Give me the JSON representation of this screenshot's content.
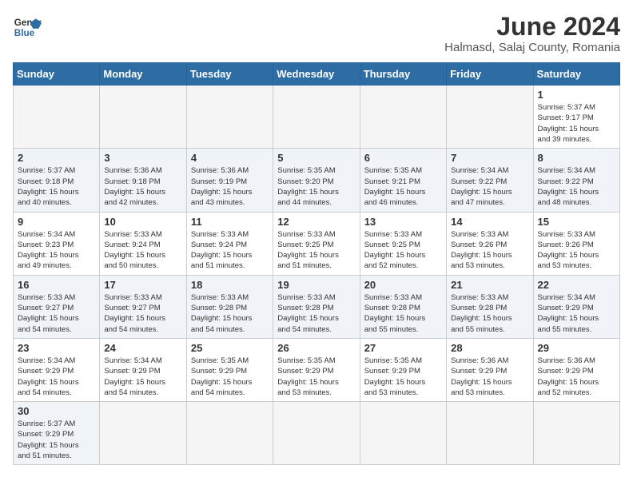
{
  "header": {
    "logo_general": "General",
    "logo_blue": "Blue",
    "month_year": "June 2024",
    "location": "Halmasd, Salaj County, Romania"
  },
  "weekdays": [
    "Sunday",
    "Monday",
    "Tuesday",
    "Wednesday",
    "Thursday",
    "Friday",
    "Saturday"
  ],
  "weeks": [
    [
      {
        "day": "",
        "info": ""
      },
      {
        "day": "",
        "info": ""
      },
      {
        "day": "",
        "info": ""
      },
      {
        "day": "",
        "info": ""
      },
      {
        "day": "",
        "info": ""
      },
      {
        "day": "",
        "info": ""
      },
      {
        "day": "1",
        "info": "Sunrise: 5:37 AM\nSunset: 9:17 PM\nDaylight: 15 hours\nand 39 minutes."
      }
    ],
    [
      {
        "day": "2",
        "info": "Sunrise: 5:37 AM\nSunset: 9:18 PM\nDaylight: 15 hours\nand 40 minutes."
      },
      {
        "day": "3",
        "info": "Sunrise: 5:36 AM\nSunset: 9:18 PM\nDaylight: 15 hours\nand 42 minutes."
      },
      {
        "day": "4",
        "info": "Sunrise: 5:36 AM\nSunset: 9:19 PM\nDaylight: 15 hours\nand 43 minutes."
      },
      {
        "day": "5",
        "info": "Sunrise: 5:35 AM\nSunset: 9:20 PM\nDaylight: 15 hours\nand 44 minutes."
      },
      {
        "day": "6",
        "info": "Sunrise: 5:35 AM\nSunset: 9:21 PM\nDaylight: 15 hours\nand 46 minutes."
      },
      {
        "day": "7",
        "info": "Sunrise: 5:34 AM\nSunset: 9:22 PM\nDaylight: 15 hours\nand 47 minutes."
      },
      {
        "day": "8",
        "info": "Sunrise: 5:34 AM\nSunset: 9:22 PM\nDaylight: 15 hours\nand 48 minutes."
      }
    ],
    [
      {
        "day": "9",
        "info": "Sunrise: 5:34 AM\nSunset: 9:23 PM\nDaylight: 15 hours\nand 49 minutes."
      },
      {
        "day": "10",
        "info": "Sunrise: 5:33 AM\nSunset: 9:24 PM\nDaylight: 15 hours\nand 50 minutes."
      },
      {
        "day": "11",
        "info": "Sunrise: 5:33 AM\nSunset: 9:24 PM\nDaylight: 15 hours\nand 51 minutes."
      },
      {
        "day": "12",
        "info": "Sunrise: 5:33 AM\nSunset: 9:25 PM\nDaylight: 15 hours\nand 51 minutes."
      },
      {
        "day": "13",
        "info": "Sunrise: 5:33 AM\nSunset: 9:25 PM\nDaylight: 15 hours\nand 52 minutes."
      },
      {
        "day": "14",
        "info": "Sunrise: 5:33 AM\nSunset: 9:26 PM\nDaylight: 15 hours\nand 53 minutes."
      },
      {
        "day": "15",
        "info": "Sunrise: 5:33 AM\nSunset: 9:26 PM\nDaylight: 15 hours\nand 53 minutes."
      }
    ],
    [
      {
        "day": "16",
        "info": "Sunrise: 5:33 AM\nSunset: 9:27 PM\nDaylight: 15 hours\nand 54 minutes."
      },
      {
        "day": "17",
        "info": "Sunrise: 5:33 AM\nSunset: 9:27 PM\nDaylight: 15 hours\nand 54 minutes."
      },
      {
        "day": "18",
        "info": "Sunrise: 5:33 AM\nSunset: 9:28 PM\nDaylight: 15 hours\nand 54 minutes."
      },
      {
        "day": "19",
        "info": "Sunrise: 5:33 AM\nSunset: 9:28 PM\nDaylight: 15 hours\nand 54 minutes."
      },
      {
        "day": "20",
        "info": "Sunrise: 5:33 AM\nSunset: 9:28 PM\nDaylight: 15 hours\nand 55 minutes."
      },
      {
        "day": "21",
        "info": "Sunrise: 5:33 AM\nSunset: 9:28 PM\nDaylight: 15 hours\nand 55 minutes."
      },
      {
        "day": "22",
        "info": "Sunrise: 5:34 AM\nSunset: 9:29 PM\nDaylight: 15 hours\nand 55 minutes."
      }
    ],
    [
      {
        "day": "23",
        "info": "Sunrise: 5:34 AM\nSunset: 9:29 PM\nDaylight: 15 hours\nand 54 minutes."
      },
      {
        "day": "24",
        "info": "Sunrise: 5:34 AM\nSunset: 9:29 PM\nDaylight: 15 hours\nand 54 minutes."
      },
      {
        "day": "25",
        "info": "Sunrise: 5:35 AM\nSunset: 9:29 PM\nDaylight: 15 hours\nand 54 minutes."
      },
      {
        "day": "26",
        "info": "Sunrise: 5:35 AM\nSunset: 9:29 PM\nDaylight: 15 hours\nand 53 minutes."
      },
      {
        "day": "27",
        "info": "Sunrise: 5:35 AM\nSunset: 9:29 PM\nDaylight: 15 hours\nand 53 minutes."
      },
      {
        "day": "28",
        "info": "Sunrise: 5:36 AM\nSunset: 9:29 PM\nDaylight: 15 hours\nand 53 minutes."
      },
      {
        "day": "29",
        "info": "Sunrise: 5:36 AM\nSunset: 9:29 PM\nDaylight: 15 hours\nand 52 minutes."
      }
    ],
    [
      {
        "day": "30",
        "info": "Sunrise: 5:37 AM\nSunset: 9:29 PM\nDaylight: 15 hours\nand 51 minutes."
      },
      {
        "day": "",
        "info": ""
      },
      {
        "day": "",
        "info": ""
      },
      {
        "day": "",
        "info": ""
      },
      {
        "day": "",
        "info": ""
      },
      {
        "day": "",
        "info": ""
      },
      {
        "day": "",
        "info": ""
      }
    ]
  ]
}
